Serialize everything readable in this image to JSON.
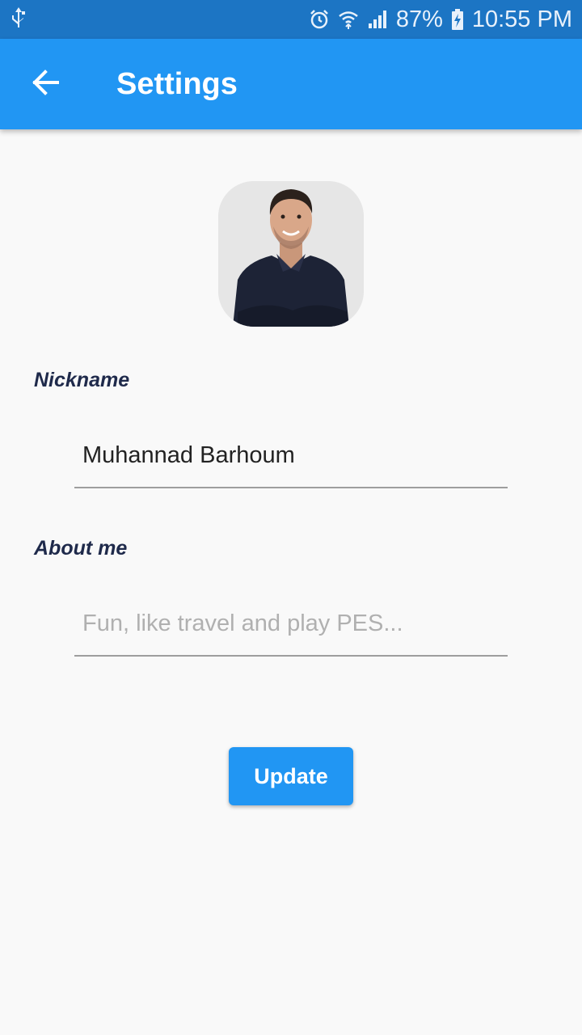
{
  "status_bar": {
    "battery": "87%",
    "time": "10:55 PM",
    "icons": [
      "usb-icon",
      "alarm-icon",
      "wifi-icon",
      "signal-icon",
      "battery-charging-icon"
    ]
  },
  "app_bar": {
    "title": "Settings",
    "back_icon": "arrow-back-icon",
    "color": "#2196f3"
  },
  "profile": {
    "avatar": "profile-photo"
  },
  "form": {
    "nickname_label": "Nickname",
    "nickname_value": "Muhannad Barhoum",
    "about_label": "About me",
    "about_placeholder": "Fun, like travel and play PES...",
    "about_value": ""
  },
  "actions": {
    "update_label": "Update"
  },
  "colors": {
    "accent": "#2196f3",
    "status_bar": "#1c75c4",
    "label": "#1f2a4b",
    "background": "#f9f9f9"
  }
}
